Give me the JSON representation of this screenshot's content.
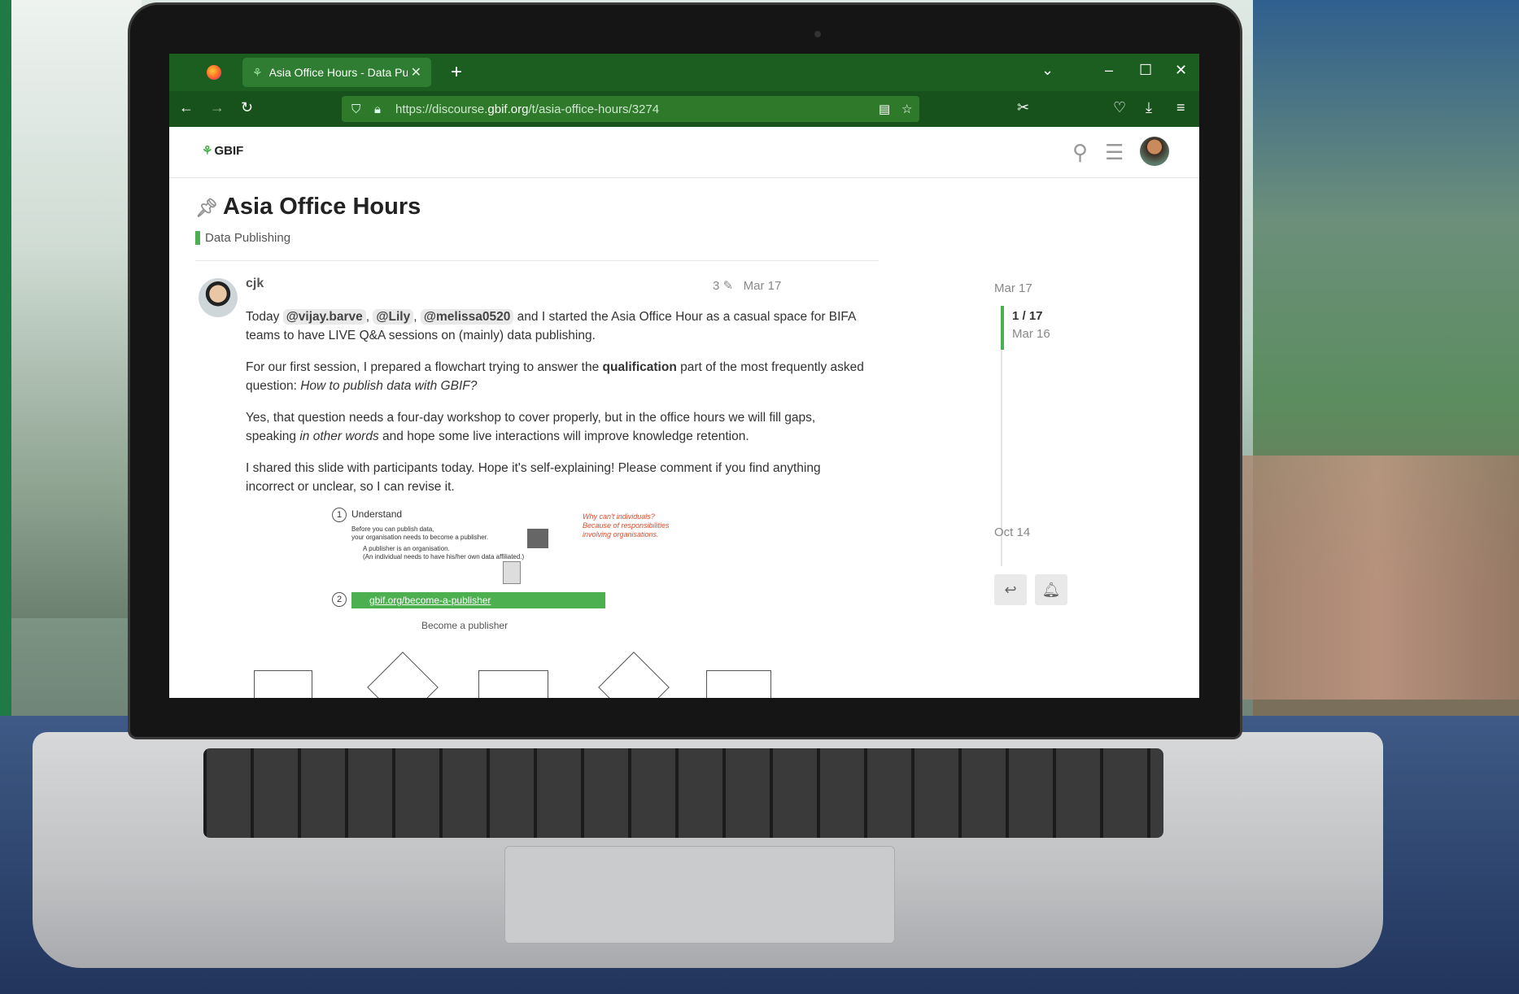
{
  "browser": {
    "tab_title": "Asia Office Hours - Data Publish",
    "tab_close": "✕",
    "new_tab": "+",
    "url_prefix": "https://discourse.",
    "url_domain": "gbif.org",
    "url_path": "/t/asia-office-hours/3274"
  },
  "site": {
    "logo_text": "GBIF"
  },
  "topic": {
    "title": "Asia Office Hours",
    "category": "Data Publishing"
  },
  "post": {
    "username": "cjk",
    "edits": "3",
    "date": "Mar 17",
    "p1_a": "Today",
    "mention1": "@vijay.barve",
    "mention2": "@Lily",
    "mention3": "@melissa0520",
    "p1_b": "and I started the Asia Office Hour as a casual space for BIFA teams to have LIVE Q&A sessions on (mainly) data publishing.",
    "p2_a": "For our first session, I prepared a flowchart trying to answer the",
    "p2_bold": "qualification",
    "p2_b": "part of the most frequently asked question:",
    "p2_italic": "How to publish data with GBIF?",
    "p3_a": "Yes, that question needs a four-day workshop to cover properly, but in the office hours we will fill gaps, speaking",
    "p3_italic": "in other words",
    "p3_b": "and hope some live interactions will improve knowledge retention.",
    "p4": "I shared this slide with participants today. Hope it's self-explaining! Please comment if you find anything incorrect or unclear, so I can revise it."
  },
  "flowchart": {
    "step1_num": "1",
    "step1_title": "Understand",
    "step1_line1": "Before you can publish data,",
    "step1_line2": "your organisation needs to become a publisher.",
    "step1_line3": "A publisher is an organisation.",
    "step1_line4": "(An individual needs to have his/her own data affiliated.)",
    "note": "Why can't individuals? Because of responsibilities involving organisations.",
    "step2_num": "2",
    "step2_url": "gbif.org/become-a-publisher",
    "step2_page_title": "Become a publisher"
  },
  "timeline": {
    "start_date": "Mar 17",
    "position": "1 / 17",
    "position_date": "Mar 16",
    "end_date": "Oct 14"
  }
}
